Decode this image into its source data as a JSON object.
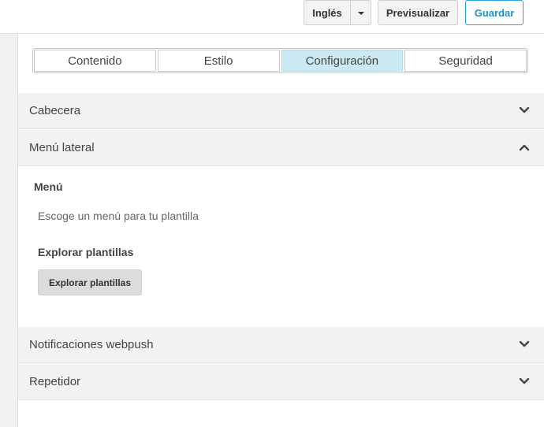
{
  "toolbar": {
    "language_label": "Inglés",
    "preview_label": "Previsualizar",
    "save_label": "Guardar",
    "accent_color": "#1b95c8"
  },
  "tabs": [
    {
      "label": "Contenido",
      "active": false
    },
    {
      "label": "Estilo",
      "active": false
    },
    {
      "label": "Configuración",
      "active": true
    },
    {
      "label": "Seguridad",
      "active": false
    }
  ],
  "sections": {
    "header": {
      "label": "Cabecera",
      "expanded": false,
      "icon": "chevron-down-icon"
    },
    "side_menu": {
      "label": "Menú lateral",
      "expanded": true,
      "icon": "chevron-up-icon"
    },
    "webpush": {
      "label": "Notificaciones webpush",
      "expanded": false,
      "icon": "chevron-down-icon"
    },
    "repeater": {
      "label": "Repetidor",
      "expanded": false,
      "icon": "chevron-down-icon"
    }
  },
  "side_menu_panel": {
    "title": "Menú",
    "description": "Escoge un menú para tu plantilla",
    "subtitle": "Explorar plantillas",
    "button_label": "Explorar plantillas"
  }
}
